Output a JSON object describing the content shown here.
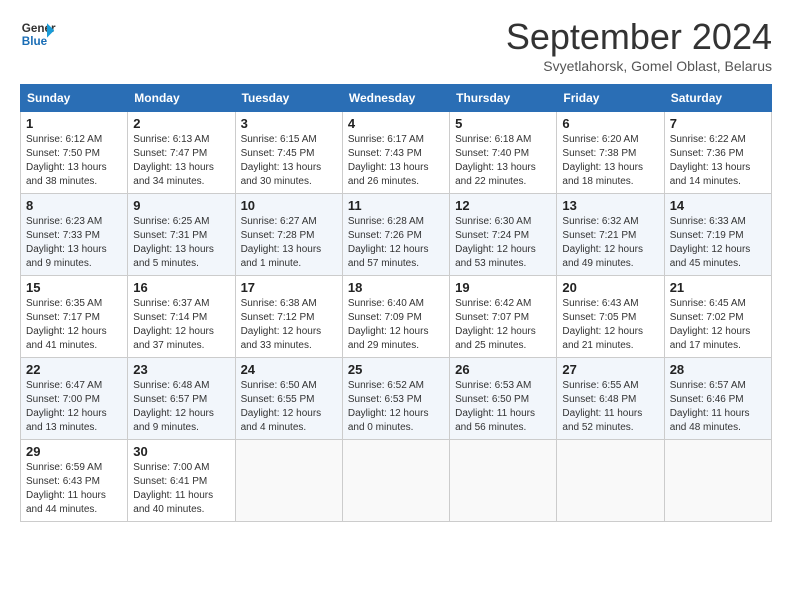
{
  "header": {
    "logo_line1": "General",
    "logo_line2": "Blue",
    "month": "September 2024",
    "location": "Svyetlahorsk, Gomel Oblast, Belarus"
  },
  "weekdays": [
    "Sunday",
    "Monday",
    "Tuesday",
    "Wednesday",
    "Thursday",
    "Friday",
    "Saturday"
  ],
  "weeks": [
    [
      {
        "day": "1",
        "info": "Sunrise: 6:12 AM\nSunset: 7:50 PM\nDaylight: 13 hours\nand 38 minutes."
      },
      {
        "day": "2",
        "info": "Sunrise: 6:13 AM\nSunset: 7:47 PM\nDaylight: 13 hours\nand 34 minutes."
      },
      {
        "day": "3",
        "info": "Sunrise: 6:15 AM\nSunset: 7:45 PM\nDaylight: 13 hours\nand 30 minutes."
      },
      {
        "day": "4",
        "info": "Sunrise: 6:17 AM\nSunset: 7:43 PM\nDaylight: 13 hours\nand 26 minutes."
      },
      {
        "day": "5",
        "info": "Sunrise: 6:18 AM\nSunset: 7:40 PM\nDaylight: 13 hours\nand 22 minutes."
      },
      {
        "day": "6",
        "info": "Sunrise: 6:20 AM\nSunset: 7:38 PM\nDaylight: 13 hours\nand 18 minutes."
      },
      {
        "day": "7",
        "info": "Sunrise: 6:22 AM\nSunset: 7:36 PM\nDaylight: 13 hours\nand 14 minutes."
      }
    ],
    [
      {
        "day": "8",
        "info": "Sunrise: 6:23 AM\nSunset: 7:33 PM\nDaylight: 13 hours\nand 9 minutes."
      },
      {
        "day": "9",
        "info": "Sunrise: 6:25 AM\nSunset: 7:31 PM\nDaylight: 13 hours\nand 5 minutes."
      },
      {
        "day": "10",
        "info": "Sunrise: 6:27 AM\nSunset: 7:28 PM\nDaylight: 13 hours\nand 1 minute."
      },
      {
        "day": "11",
        "info": "Sunrise: 6:28 AM\nSunset: 7:26 PM\nDaylight: 12 hours\nand 57 minutes."
      },
      {
        "day": "12",
        "info": "Sunrise: 6:30 AM\nSunset: 7:24 PM\nDaylight: 12 hours\nand 53 minutes."
      },
      {
        "day": "13",
        "info": "Sunrise: 6:32 AM\nSunset: 7:21 PM\nDaylight: 12 hours\nand 49 minutes."
      },
      {
        "day": "14",
        "info": "Sunrise: 6:33 AM\nSunset: 7:19 PM\nDaylight: 12 hours\nand 45 minutes."
      }
    ],
    [
      {
        "day": "15",
        "info": "Sunrise: 6:35 AM\nSunset: 7:17 PM\nDaylight: 12 hours\nand 41 minutes."
      },
      {
        "day": "16",
        "info": "Sunrise: 6:37 AM\nSunset: 7:14 PM\nDaylight: 12 hours\nand 37 minutes."
      },
      {
        "day": "17",
        "info": "Sunrise: 6:38 AM\nSunset: 7:12 PM\nDaylight: 12 hours\nand 33 minutes."
      },
      {
        "day": "18",
        "info": "Sunrise: 6:40 AM\nSunset: 7:09 PM\nDaylight: 12 hours\nand 29 minutes."
      },
      {
        "day": "19",
        "info": "Sunrise: 6:42 AM\nSunset: 7:07 PM\nDaylight: 12 hours\nand 25 minutes."
      },
      {
        "day": "20",
        "info": "Sunrise: 6:43 AM\nSunset: 7:05 PM\nDaylight: 12 hours\nand 21 minutes."
      },
      {
        "day": "21",
        "info": "Sunrise: 6:45 AM\nSunset: 7:02 PM\nDaylight: 12 hours\nand 17 minutes."
      }
    ],
    [
      {
        "day": "22",
        "info": "Sunrise: 6:47 AM\nSunset: 7:00 PM\nDaylight: 12 hours\nand 13 minutes."
      },
      {
        "day": "23",
        "info": "Sunrise: 6:48 AM\nSunset: 6:57 PM\nDaylight: 12 hours\nand 9 minutes."
      },
      {
        "day": "24",
        "info": "Sunrise: 6:50 AM\nSunset: 6:55 PM\nDaylight: 12 hours\nand 4 minutes."
      },
      {
        "day": "25",
        "info": "Sunrise: 6:52 AM\nSunset: 6:53 PM\nDaylight: 12 hours\nand 0 minutes."
      },
      {
        "day": "26",
        "info": "Sunrise: 6:53 AM\nSunset: 6:50 PM\nDaylight: 11 hours\nand 56 minutes."
      },
      {
        "day": "27",
        "info": "Sunrise: 6:55 AM\nSunset: 6:48 PM\nDaylight: 11 hours\nand 52 minutes."
      },
      {
        "day": "28",
        "info": "Sunrise: 6:57 AM\nSunset: 6:46 PM\nDaylight: 11 hours\nand 48 minutes."
      }
    ],
    [
      {
        "day": "29",
        "info": "Sunrise: 6:59 AM\nSunset: 6:43 PM\nDaylight: 11 hours\nand 44 minutes."
      },
      {
        "day": "30",
        "info": "Sunrise: 7:00 AM\nSunset: 6:41 PM\nDaylight: 11 hours\nand 40 minutes."
      },
      {
        "day": "",
        "info": ""
      },
      {
        "day": "",
        "info": ""
      },
      {
        "day": "",
        "info": ""
      },
      {
        "day": "",
        "info": ""
      },
      {
        "day": "",
        "info": ""
      }
    ]
  ]
}
